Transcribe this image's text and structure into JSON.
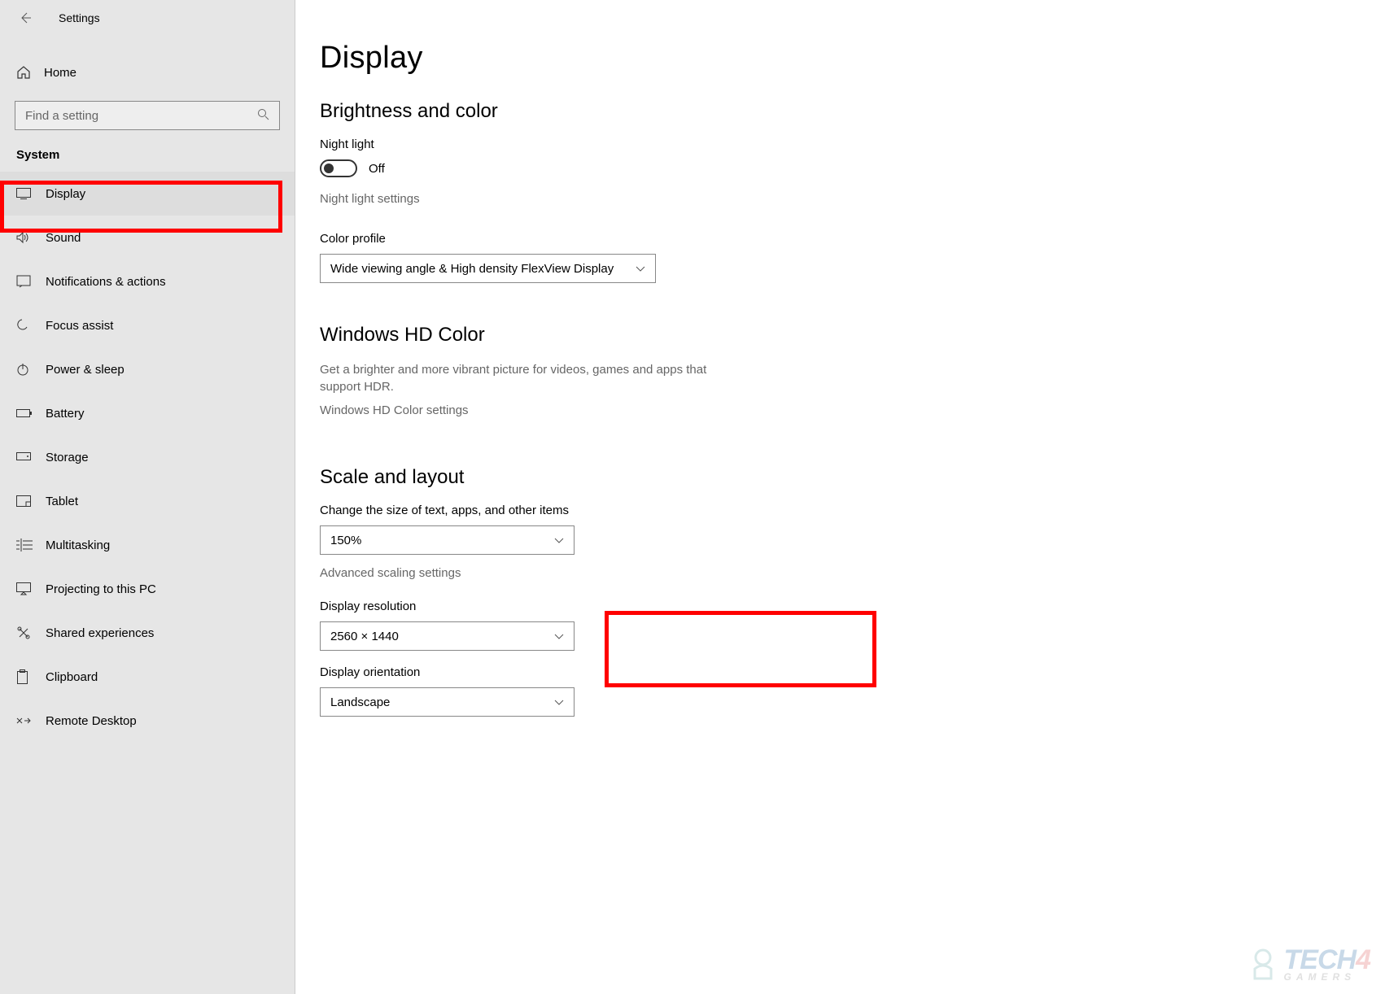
{
  "header": {
    "title": "Settings"
  },
  "home_label": "Home",
  "search": {
    "placeholder": "Find a setting"
  },
  "category": "System",
  "sidebar": {
    "items": [
      {
        "label": "Display"
      },
      {
        "label": "Sound"
      },
      {
        "label": "Notifications & actions"
      },
      {
        "label": "Focus assist"
      },
      {
        "label": "Power & sleep"
      },
      {
        "label": "Battery"
      },
      {
        "label": "Storage"
      },
      {
        "label": "Tablet"
      },
      {
        "label": "Multitasking"
      },
      {
        "label": "Projecting to this PC"
      },
      {
        "label": "Shared experiences"
      },
      {
        "label": "Clipboard"
      },
      {
        "label": "Remote Desktop"
      }
    ]
  },
  "main": {
    "title": "Display",
    "brightness": {
      "heading": "Brightness and color",
      "night_light_label": "Night light",
      "night_light_state": "Off",
      "night_light_settings": "Night light settings",
      "color_profile_label": "Color profile",
      "color_profile_value": "Wide viewing angle & High density FlexView Display"
    },
    "hdcolor": {
      "heading": "Windows HD Color",
      "desc": "Get a brighter and more vibrant picture for videos, games and apps that support HDR.",
      "link": "Windows HD Color settings"
    },
    "scale": {
      "heading": "Scale and layout",
      "text_size_label": "Change the size of text, apps, and other items",
      "text_size_value": "150%",
      "advanced": "Advanced scaling settings",
      "resolution_label": "Display resolution",
      "resolution_value": "2560 × 1440",
      "orientation_label": "Display orientation",
      "orientation_value": "Landscape"
    }
  },
  "watermark": {
    "brand": "TECH",
    "num": "4",
    "sub": "GAMERS"
  }
}
